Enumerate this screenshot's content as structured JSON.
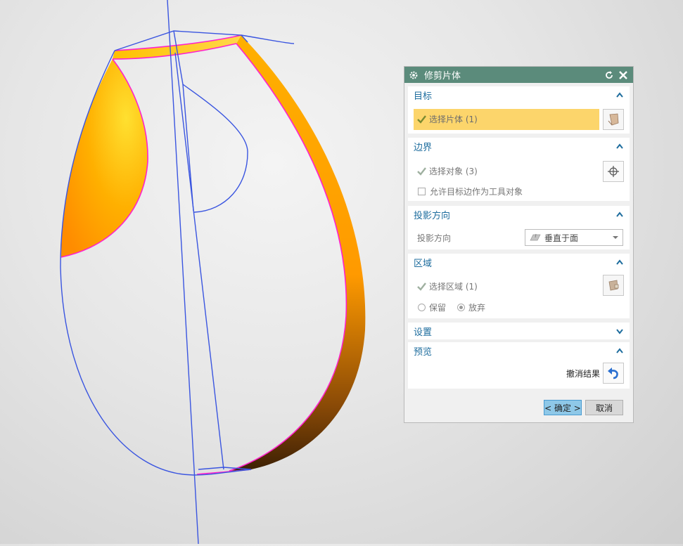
{
  "dialog": {
    "title": "修剪片体",
    "sections": {
      "target": {
        "heading": "目标",
        "select_label": "选择片体 (1)"
      },
      "boundary": {
        "heading": "边界",
        "select_label": "选择对象 (3)",
        "allow_edges_label": "允许目标边作为工具对象"
      },
      "projection": {
        "heading": "投影方向",
        "field_label": "投影方向",
        "selected_value": "垂直于面"
      },
      "region": {
        "heading": "区域",
        "select_label": "选择区域 (1)",
        "keep_label": "保留",
        "discard_label": "放弃",
        "selected_option": "放弃"
      },
      "settings": {
        "heading": "设置"
      },
      "preview": {
        "heading": "预览",
        "undo_label": "撤消结果"
      }
    },
    "buttons": {
      "ok_label": "< 确定 >",
      "cancel_label": "取消"
    }
  },
  "colors": {
    "titlebar": "#5b8b7b",
    "section_heading": "#1e6d9e",
    "selection_highlight": "#fcd56b",
    "wireframe": "#3a55e0",
    "edge_highlight": "#ff22cc",
    "surface": "#ffb300"
  },
  "icons": [
    "gear-icon",
    "reset-icon",
    "close-icon",
    "chevron-up-icon",
    "chevron-down-icon",
    "check-icon",
    "sheet-body-icon",
    "crosshair-icon",
    "region-icon",
    "undo-icon",
    "face-normal-icon",
    "dropdown-arrow-icon"
  ]
}
